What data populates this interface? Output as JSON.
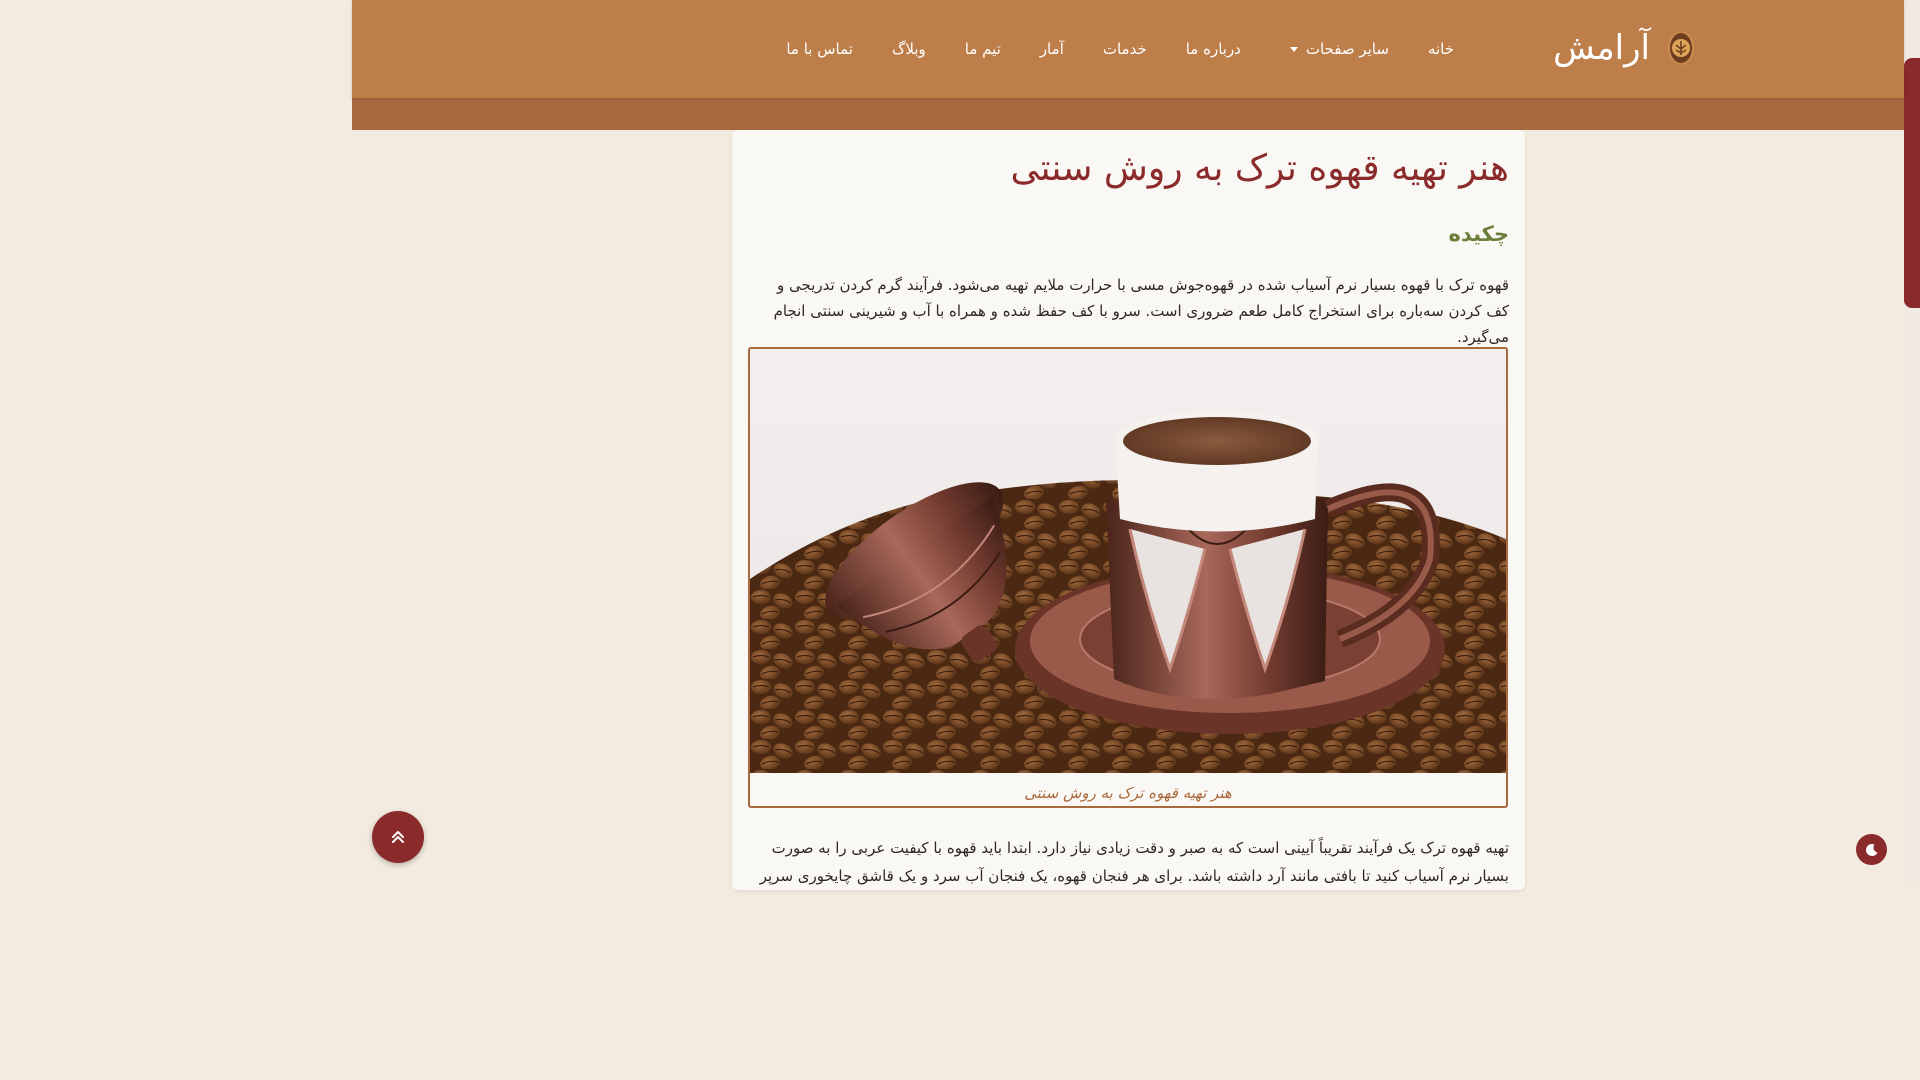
{
  "brand": {
    "name": "آرامش",
    "logo_icon": "coffee-bean-logo-icon"
  },
  "nav": {
    "items": [
      {
        "label": "خانه"
      },
      {
        "label": "سایر صفحات",
        "has_dropdown": true
      },
      {
        "label": "درباره ما"
      },
      {
        "label": "خدمات"
      },
      {
        "label": "آمار"
      },
      {
        "label": "تیم ما"
      },
      {
        "label": "وبلاگ"
      },
      {
        "label": "تماس با ما"
      }
    ]
  },
  "article": {
    "title": "هنر تهیه قهوه ترک به روش سنتی",
    "abstract_heading": "چکیده",
    "abstract": "قهوه ترک با قهوه بسیار نرم آسیاب شده در قهوه‌جوش مسی با حرارت ملایم تهیه می‌شود. فرآیند گرم کردن تدریجی و کف کردن سه‌باره برای استخراج کامل طعم ضروری است. سرو با کف حفظ شده و همراه با آب و شیرینی سنتی انجام می‌گیرد.",
    "figure_caption": "هنر تهیه قهوه ترک به روش سنتی",
    "body": "تهیه قهوه ترک یک فرآیند تقریباً آیینی است که به صبر و دقت زیادی نیاز دارد. ابتدا باید قهوه با کیفیت عربی را به صورت بسیار نرم آسیاب کنید تا بافتی مانند آرد داشته باشد. برای هر فنجان قهوه، یک فنجان آب سرد و یک قاشق چایخوری سرپر"
  },
  "controls": {
    "back_to_top_icon": "double-chevron-up-icon",
    "theme_toggle_icon": "moon-icon"
  },
  "colors": {
    "navbar": "#bd7e4a",
    "band": "#a8693f",
    "title": "#8a2a2a",
    "subhead": "#6b7f3a",
    "background": "#f3ebe0"
  }
}
